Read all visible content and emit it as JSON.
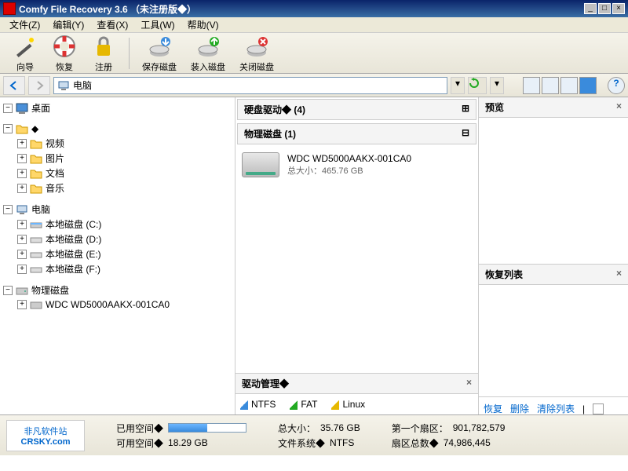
{
  "window": {
    "title": "Comfy File Recovery 3.6 （未注册版◆）",
    "min": "_",
    "max": "□",
    "close": "×"
  },
  "menu": {
    "file": "文件(Z)",
    "edit": "编辑(Y)",
    "view": "查看(X)",
    "tools": "工具(W)",
    "help": "帮助(V)"
  },
  "toolbar": {
    "wizard": "向导",
    "recover": "恢复",
    "register": "注册",
    "save_disk": "保存磁盘",
    "load_disk": "装入磁盘",
    "close_disk": "关闭磁盘"
  },
  "address": {
    "value": "电脑"
  },
  "tree": {
    "desktop": "桌面",
    "user": "◆",
    "video": "视频",
    "pictures": "图片",
    "documents": "文档",
    "music": "音乐",
    "computer": "电脑",
    "disk_c": "本地磁盘 (C:)",
    "disk_d": "本地磁盘 (D:)",
    "disk_e": "本地磁盘 (E:)",
    "disk_f": "本地磁盘 (F:)",
    "physical": "物理磁盘",
    "wdc": "WDC WD5000AAKX-001CA0"
  },
  "center": {
    "hdd_header": "硬盘驱动◆ (4)",
    "phys_header": "物理磁盘 (1)",
    "device_name": "WDC WD5000AAKX-001CA0",
    "device_size": "总大小：465.76 GB",
    "drive_mgmt": "驱动管理◆",
    "fs": {
      "ntfs": "NTFS",
      "fat": "FAT",
      "linux": "Linux"
    }
  },
  "right": {
    "preview": "预览",
    "recovery_list": "恢复列表",
    "recover": "恢复",
    "delete": "删除",
    "clear": "清除列表"
  },
  "status": {
    "logo_cn": "非凡软件站",
    "logo_en": "CRSKY.com",
    "used_label": "已用空间◆",
    "used_val": "",
    "free_label": "可用空间◆",
    "free_val": "18.29 GB",
    "total_label": "总大小：",
    "total_val": "35.76 GB",
    "fs_label": "文件系统◆",
    "fs_val": "NTFS",
    "first_sector_label": "第一个扇区：",
    "first_sector_val": "901,782,579",
    "sector_count_label": "扇区总数◆",
    "sector_count_val": "74,986,445",
    "progress_pct": 50
  }
}
